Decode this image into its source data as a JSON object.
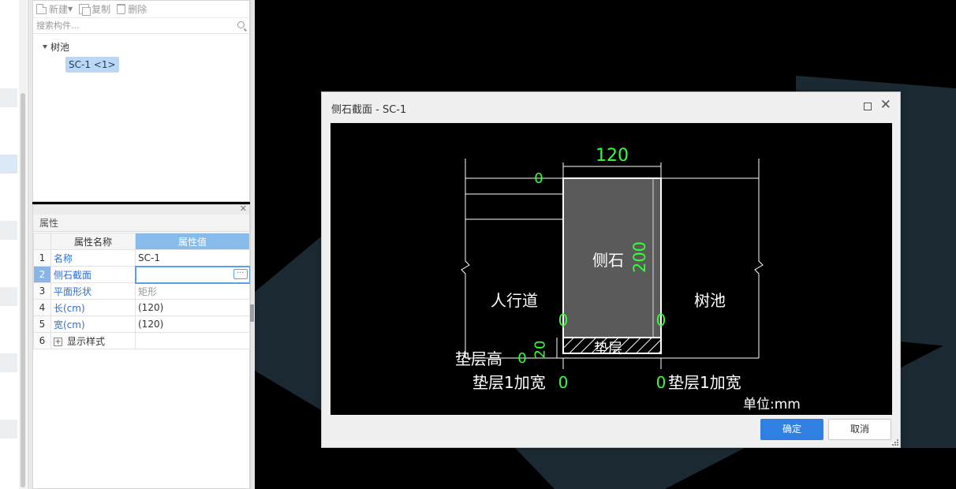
{
  "toolbar": {
    "new_label": "新建",
    "copy_label": "复制",
    "delete_label": "删除"
  },
  "search": {
    "placeholder": "搜索构件..."
  },
  "tree": {
    "root_label": "树池",
    "child_label": "SC-1 <1>"
  },
  "properties": {
    "title": "属性",
    "header_name": "属性名称",
    "header_value": "属性值",
    "rows": [
      {
        "num": "1",
        "name": "名称",
        "value": "SC-1"
      },
      {
        "num": "2",
        "name": "侧石截面",
        "value": ""
      },
      {
        "num": "3",
        "name": "平面形状",
        "value": "矩形"
      },
      {
        "num": "4",
        "name": "长(cm)",
        "value": "(120)"
      },
      {
        "num": "5",
        "name": "宽(cm)",
        "value": "(120)"
      },
      {
        "num": "6",
        "name": "显示样式",
        "value": ""
      }
    ]
  },
  "dialog": {
    "title": "侧石截面 - SC-1",
    "ok_label": "确定",
    "cancel_label": "取消"
  },
  "diagram": {
    "width_value": "120",
    "height_value": "200",
    "stone_label": "侧石",
    "sidewalk_label": "人行道",
    "treepit_label": "树池",
    "cushion_label": "垫层",
    "cushion_height_label": "垫层高",
    "cushion_height_value": "20",
    "left_widen_label": "垫层1加宽",
    "right_widen_label": "垫层1加宽",
    "left_widen_value": "0",
    "right_widen_value": "0",
    "top_offset_value": "0",
    "left_side_value": "0",
    "right_side_value": "0",
    "cushion_side_value": "0",
    "unit_label": "单位:mm"
  },
  "colors": {
    "dimension_green": "#33ff33",
    "accent_blue": "#2f80e2"
  }
}
